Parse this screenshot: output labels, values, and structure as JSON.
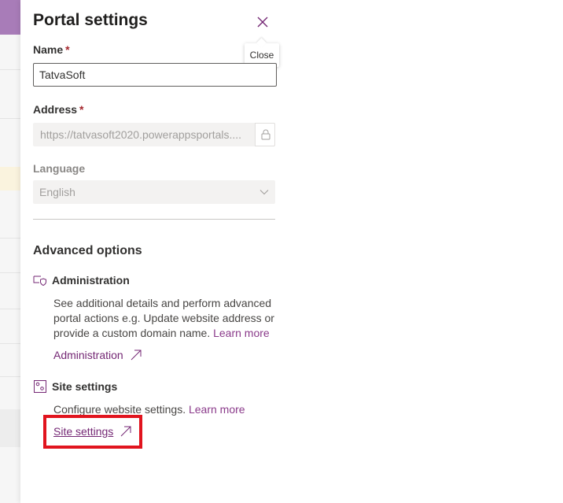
{
  "panel": {
    "title": "Portal settings",
    "close_tooltip": "Close"
  },
  "fields": {
    "name": {
      "label": "Name",
      "required_mark": "*",
      "value": "TatvaSoft"
    },
    "address": {
      "label": "Address",
      "required_mark": "*",
      "value": "https://tatvasoft2020.powerappsportals...."
    },
    "language": {
      "label": "Language",
      "value": "English"
    }
  },
  "advanced": {
    "title": "Advanced options",
    "administration": {
      "heading": "Administration",
      "description": "See additional details and perform advanced portal actions e.g. Update website address or provide a custom domain name.",
      "learn_more": "Learn more",
      "link_label": "Administration"
    },
    "site_settings": {
      "heading": "Site settings",
      "description": "Configure website settings.",
      "learn_more": "Learn more",
      "link_label": "Site settings"
    }
  },
  "colors": {
    "accent": "#742774",
    "highlight": "#e1141e"
  },
  "icons": {
    "close": "close-icon",
    "lock": "lock-icon",
    "chevron": "chevron-down-icon",
    "admin": "admin-shield-icon",
    "settings": "site-settings-icon",
    "external": "external-arrow-icon"
  }
}
